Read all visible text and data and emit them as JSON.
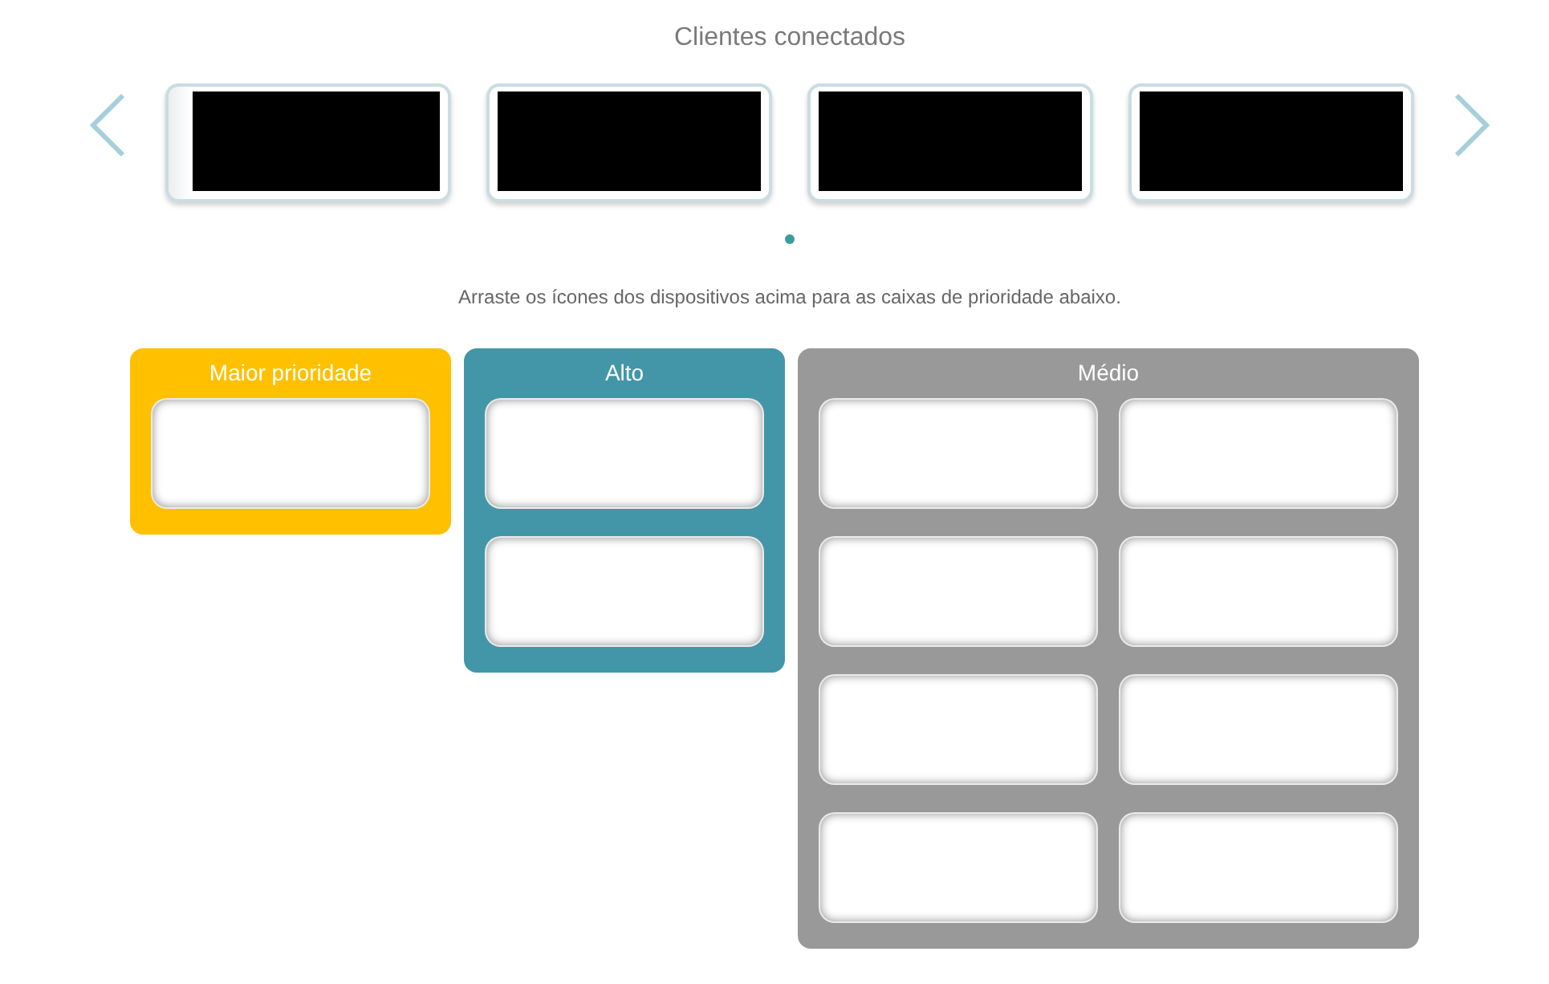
{
  "title": "Clientes conectados",
  "carousel": {
    "devices": [
      {
        "kind": "redacted"
      },
      {
        "kind": "redacted"
      },
      {
        "kind": "redacted"
      },
      {
        "kind": "redacted"
      }
    ],
    "pages": [
      {
        "selected": true
      }
    ]
  },
  "instruction": "Arraste os ícones dos dispositivos acima para as caixas de prioridade abaixo.",
  "priority_groups": [
    {
      "title": "Maior prioridade",
      "color": "#ffc000",
      "slot_rows": [
        {
          "slots": [
            {
              "kind": "empty"
            }
          ]
        }
      ]
    },
    {
      "title": "Alto",
      "color": "#4396a8",
      "slot_rows": [
        {
          "slots": [
            {
              "kind": "empty"
            }
          ]
        },
        {
          "slots": [
            {
              "kind": "empty"
            }
          ]
        }
      ]
    },
    {
      "title": "Médio",
      "color": "#999999",
      "slot_rows": [
        {
          "slots": [
            {
              "kind": "empty"
            },
            {
              "kind": "empty"
            }
          ]
        },
        {
          "slots": [
            {
              "kind": "empty"
            },
            {
              "kind": "empty"
            }
          ]
        },
        {
          "slots": [
            {
              "kind": "empty"
            },
            {
              "kind": "empty"
            }
          ]
        },
        {
          "slots": [
            {
              "kind": "empty"
            },
            {
              "kind": "empty"
            }
          ]
        }
      ]
    }
  ]
}
